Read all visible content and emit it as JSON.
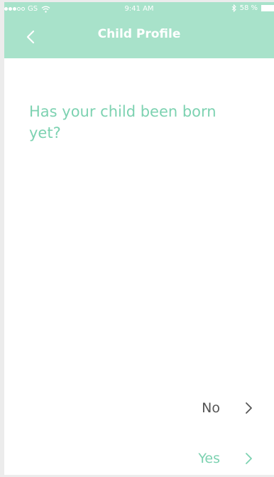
{
  "status_bar": {
    "carrier": "GS",
    "time": "9:41 AM",
    "battery_percent": "58 %",
    "signal_strength": 3,
    "signal_max": 5,
    "icons": [
      "wifi-icon",
      "bluetooth-icon",
      "battery-icon"
    ]
  },
  "header": {
    "title": "Child Profile",
    "back_icon": "chevron-left-icon"
  },
  "question": {
    "text": "Has your child been born yet?"
  },
  "answers": [
    {
      "label": "No",
      "icon": "chevron-right-icon",
      "color": "#555555"
    },
    {
      "label": "Yes",
      "icon": "chevron-right-icon",
      "color": "#7dd2b1"
    }
  ],
  "colors": {
    "header_background": "#a8e2ca",
    "accent": "#7dd2b1",
    "background": "#ffffff"
  }
}
